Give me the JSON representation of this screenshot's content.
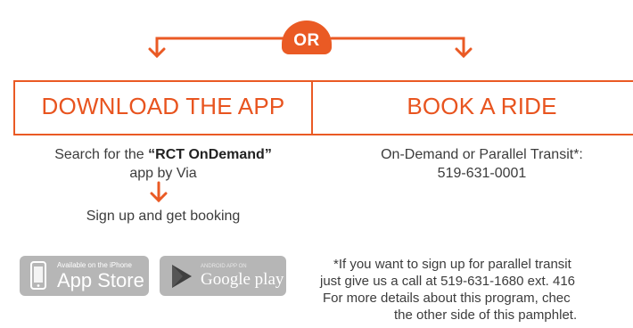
{
  "or_label": "OR",
  "left": {
    "title": "DOWNLOAD THE APP",
    "search_prefix": "Search for the ",
    "search_app_name": "“RCT OnDemand”",
    "search_suffix": "app by Via",
    "signup": "Sign up and get booking"
  },
  "right": {
    "title": "BOOK A RIDE",
    "line1": "On-Demand or Parallel Transit*:",
    "line2": "519-631-0001",
    "note": [
      "*If you want to sign up for parallel transit",
      "just give us a call at 519-631-1680 ext. 416",
      "For more details about this program, chec",
      "the other side of this pamphlet."
    ]
  },
  "app_store": {
    "small": "Available on the iPhone",
    "big": "App Store"
  },
  "google_play": {
    "small": "ANDROID APP ON",
    "big": "Google play"
  },
  "colors": {
    "accent": "#ea5a24",
    "text": "#3c3c3c",
    "badge_gray": "#b6b6b6"
  }
}
